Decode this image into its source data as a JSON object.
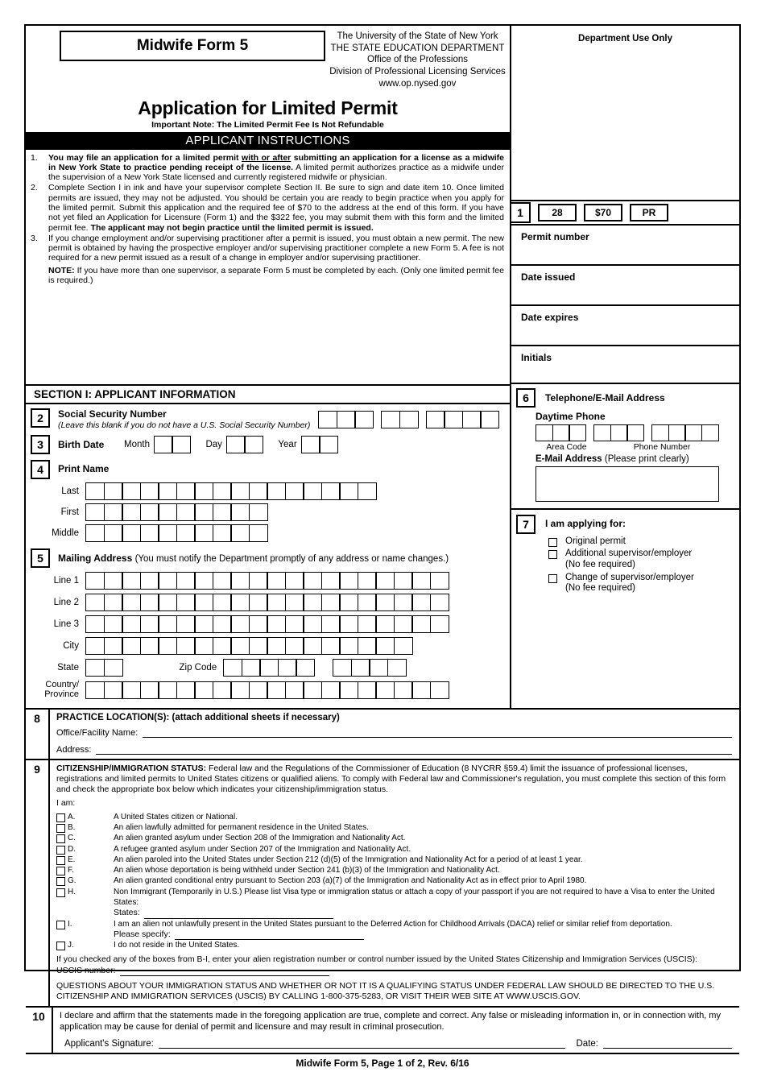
{
  "header": {
    "form_title": "Midwife Form 5",
    "agency_line1": "The University of the State of New York",
    "agency_line2": "THE STATE EDUCATION DEPARTMENT",
    "agency_line3": "Office of the Professions",
    "agency_line4": "Division of Professional Licensing Services",
    "agency_line5": "www.op.nysed.gov",
    "application_title": "Application for Limited Permit",
    "important_note": "Important Note: The Limited Permit Fee Is Not Refundable",
    "instructions_bar": "APPLICANT INSTRUCTIONS"
  },
  "instructions": [
    {
      "number": "1.",
      "bold_lead": "You may file an application for a limited permit ",
      "underlined": "with or after",
      "bold_cont": " submitting an application for a license as a midwife in New York State to practice pending receipt of the license.",
      "rest": " A limited permit authorizes practice as a midwife under the supervision of a New York State licensed and currently registered midwife or physician."
    },
    {
      "number": "2.",
      "text": "Complete Section I in ink and have your supervisor complete Section II. Be sure to sign and date item 10. Once limited permits are issued, they may not be adjusted. You should be certain you are ready to begin practice when you apply for the limited permit. Submit this application and the required fee of $70 to the address at the end of this form. If you have not yet filed an Application for Licensure (Form 1) and the $322 fee, you may submit them with this form and the limited permit fee. ",
      "bold_tail": "The applicant may not begin practice until the limited permit is issued."
    },
    {
      "number": "3.",
      "text": "If you change employment and/or supervising practitioner after a permit is issued, you must obtain a new permit. The new permit is obtained by having the prospective employer and/or supervising practitioner complete a new Form 5. A fee is not required for a new permit issued as a result of a change in employer and/or supervising practitioner."
    }
  ],
  "note": {
    "label": "NOTE:",
    "text": " If you have more than one supervisor, a separate Form 5 must be completed by each. (Only one limited permit fee is required.)"
  },
  "department_use": {
    "title": "Department Use Only",
    "box_number": "1",
    "codes": [
      "28",
      "$70",
      "PR"
    ],
    "rows": [
      "Permit number",
      "Date issued",
      "Date expires",
      "Initials"
    ]
  },
  "section1": {
    "title": "SECTION I: APPLICANT INFORMATION",
    "ssn": {
      "number": "2",
      "label": "Social Security Number",
      "hint": "(Leave this blank if you do not have a U.S. Social Security Number)",
      "groups": [
        3,
        2,
        4
      ]
    },
    "birth_date": {
      "number": "3",
      "label": "Birth Date",
      "month_label": "Month",
      "day_label": "Day",
      "year_label": "Year",
      "boxes_per_part": 2
    },
    "print_name": {
      "number": "4",
      "label": "Print Name",
      "rows": [
        {
          "label": "Last",
          "boxes": 16
        },
        {
          "label": "First",
          "boxes": 10
        },
        {
          "label": "Middle",
          "boxes": 10
        }
      ]
    },
    "mailing_address": {
      "number": "5",
      "label": "Mailing Address",
      "note": "(You must notify the Department promptly of any address or name changes.)",
      "rows": [
        {
          "label": "Line 1",
          "boxes": 20
        },
        {
          "label": "Line 2",
          "boxes": 20
        },
        {
          "label": "Line 3",
          "boxes": 20
        },
        {
          "label": "City",
          "boxes": 18
        }
      ],
      "state_label": "State",
      "state_boxes": 2,
      "zip_label": "Zip Code",
      "zip_boxes": [
        5,
        4
      ],
      "country_label": "Country/ Province",
      "country_label_line1": "Country/",
      "country_label_line2": "Province",
      "country_boxes": 20
    }
  },
  "telephone": {
    "number": "6",
    "title": "Telephone/E-Mail Address",
    "daytime_label": "Daytime Phone",
    "area_boxes": 3,
    "prefix_boxes": 3,
    "line_boxes": 4,
    "area_code_label": "Area Code",
    "phone_number_label": "Phone Number",
    "email_label": "E-Mail Address",
    "email_hint": "(Please print clearly)"
  },
  "applying_for": {
    "number": "7",
    "title": "I am applying for:",
    "options": [
      {
        "label": "Original permit",
        "sub": ""
      },
      {
        "label": "Additional supervisor/employer",
        "sub": "(No fee required)"
      },
      {
        "label": "Change of supervisor/employer",
        "sub": "(No fee required)"
      }
    ]
  },
  "practice_location": {
    "number": "8",
    "title": "PRACTICE LOCATION(S): (attach additional sheets if necessary)",
    "office_label": "Office/Facility Name:",
    "address_label": "Address:"
  },
  "citizenship": {
    "number": "9",
    "heading": "CITIZENSHIP/IMMIGRATION STATUS:",
    "intro": " Federal law and the Regulations of the Commissioner of Education (8 NYCRR §59.4) limit the issuance of professional licenses, registrations and limited permits to United States citizens or qualified aliens. To comply with Federal law and Commissioner's regulation, you must complete this section of this form and check the appropriate box below which indicates your citizenship/immigration status.",
    "i_am": "I am:",
    "options": [
      {
        "letter": "A.",
        "text": "A United States citizen or National."
      },
      {
        "letter": "B.",
        "text": "An alien lawfully admitted for permanent residence in the United States."
      },
      {
        "letter": "C.",
        "text": "An alien granted asylum under Section 208 of the Immigration and Nationality Act."
      },
      {
        "letter": "D.",
        "text": "A refugee granted asylum under Section 207 of the Immigration and Nationality Act."
      },
      {
        "letter": "E.",
        "text": "An alien paroled into the United States under Section 212 (d)(5) of the Immigration and Nationality Act for a period of at least 1 year."
      },
      {
        "letter": "F.",
        "text": "An alien whose deportation is being withheld under Section 241 (b)(3) of the Immigration and Nationality Act."
      },
      {
        "letter": "G.",
        "text": "An alien granted conditional entry pursuant to Section 203 (a)(7) of the Immigration and Nationality Act as in effect prior to April 1980."
      },
      {
        "letter": "H.",
        "text": "Non Immigrant (Temporarily in U.S.) Please list Visa type or immigration status or attach a copy of your passport if you are not required to have a Visa to enter the United States:",
        "fill_label": "States:"
      },
      {
        "letter": "I.",
        "text": "I am an alien not unlawfully present in the United States pursuant to the Deferred Action for Childhood Arrivals (DACA) relief or similar relief from deportation.",
        "fill_label": "Please specify:"
      },
      {
        "letter": "J.",
        "text": "I do not reside in the United States."
      }
    ],
    "uscis_intro": "If you checked any of the boxes from B-I, enter your alien registration number or control number issued by the United States Citizenship and Immigration Services (USCIS):",
    "uscis_label": "USCIS number:",
    "questions": "QUESTIONS ABOUT YOUR IMMIGRATION STATUS AND WHETHER OR NOT IT IS A QUALIFYING STATUS UNDER FEDERAL LAW SHOULD BE DIRECTED TO THE U.S. CITIZENSHIP AND IMMIGRATION SERVICES (USCIS) BY CALLING 1-800-375-5283, OR VISIT THEIR WEB SITE AT WWW.USCIS.GOV."
  },
  "declaration": {
    "number": "10",
    "text": "I declare and affirm that the statements made in the foregoing application are true, complete and correct. Any false or misleading information in, or in connection with, my application may be cause for denial of permit and licensure and may result in criminal prosecution.",
    "signature_label": "Applicant's Signature:",
    "date_label": "Date:"
  },
  "footer": "Midwife Form 5, Page 1 of 2, Rev. 6/16"
}
